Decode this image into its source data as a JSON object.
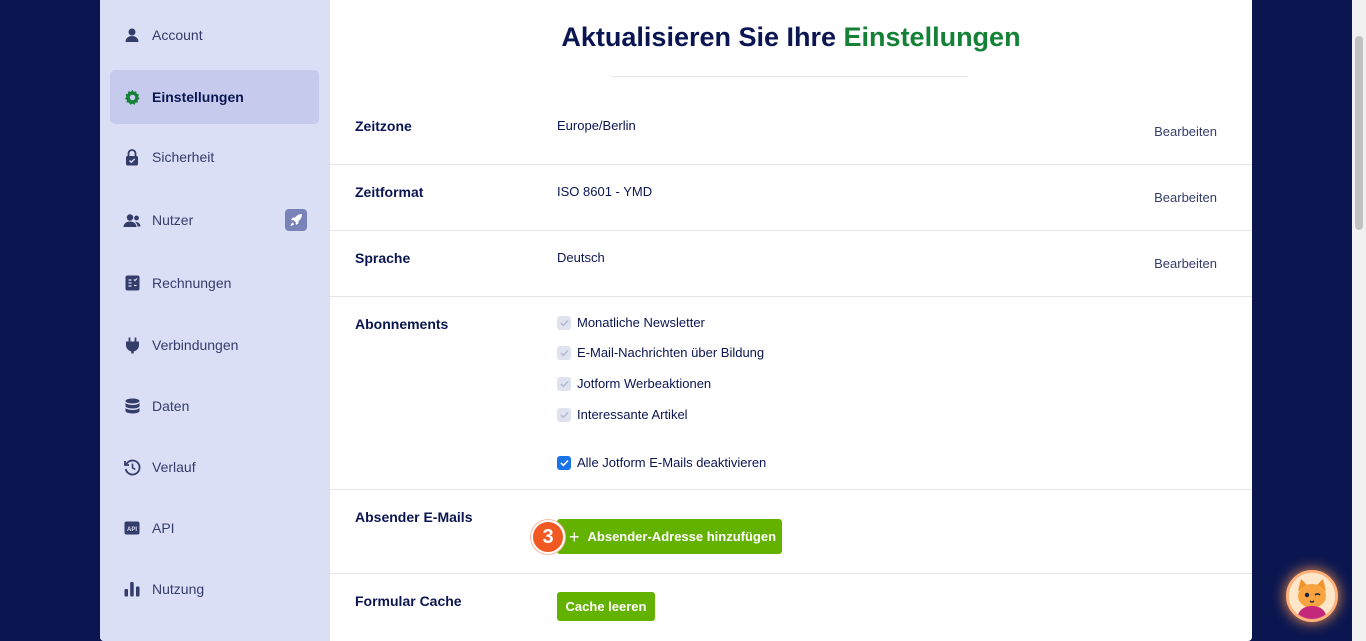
{
  "sidebar": {
    "items": [
      {
        "label": "Account",
        "icon": "user-icon"
      },
      {
        "label": "Einstellungen",
        "icon": "gear-icon",
        "active": true
      },
      {
        "label": "Sicherheit",
        "icon": "lock-icon"
      },
      {
        "label": "Nutzer",
        "icon": "users-icon",
        "badge_icon": "rocket-icon"
      },
      {
        "label": "Rechnungen",
        "icon": "invoice-icon"
      },
      {
        "label": "Verbindungen",
        "icon": "plug-icon"
      },
      {
        "label": "Daten",
        "icon": "database-icon"
      },
      {
        "label": "Verlauf",
        "icon": "history-icon"
      },
      {
        "label": "API",
        "icon": "api-icon"
      },
      {
        "label": "Nutzung",
        "icon": "bar-chart-icon"
      }
    ]
  },
  "header": {
    "title_prefix": "Aktualisieren Sie Ihre",
    "title_highlight": "Einstellungen"
  },
  "settings": {
    "zeitzone": {
      "label": "Zeitzone",
      "value": "Europe/Berlin",
      "edit": "Bearbeiten"
    },
    "zeitformat": {
      "label": "Zeitformat",
      "value": "ISO 8601 - YMD",
      "edit": "Bearbeiten"
    },
    "sprache": {
      "label": "Sprache",
      "value": "Deutsch",
      "edit": "Bearbeiten"
    },
    "abonnements": {
      "label": "Abonnements",
      "options": [
        {
          "label": "Monatliche Newsletter",
          "checked": false
        },
        {
          "label": "E-Mail-Nachrichten über Bildung",
          "checked": false
        },
        {
          "label": "Jotform Werbeaktionen",
          "checked": false
        },
        {
          "label": "Interessante Artikel",
          "checked": false
        }
      ],
      "disable_all": {
        "label": "Alle Jotform E-Mails deaktivieren",
        "checked": true
      }
    },
    "absender": {
      "label": "Absender E-Mails",
      "button": "Absender-Adresse hinzufügen",
      "step": "3"
    },
    "cache": {
      "label": "Formular Cache",
      "button": "Cache leeren"
    }
  },
  "colors": {
    "brand_navy": "#0a1551",
    "highlight_green": "#148136",
    "button_green": "#64b200",
    "step_orange": "#f05a22",
    "background": "#0b1650"
  }
}
